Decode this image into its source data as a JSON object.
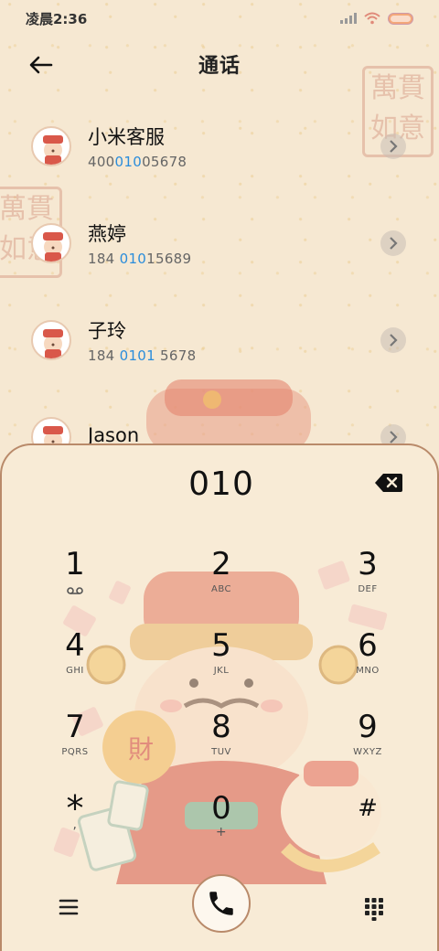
{
  "status_bar": {
    "time": "凌晨2:36"
  },
  "header": {
    "title": "通话"
  },
  "decor": {
    "seal_top_right": "萬貫\n如意",
    "seal_left": "萬貫\n如意"
  },
  "contacts": [
    {
      "name": "小米客服",
      "number_prefix": "400",
      "number_match": "010",
      "number_suffix": "05678"
    },
    {
      "name": "燕婷",
      "number_prefix": "184 ",
      "number_match": "010",
      "number_suffix": "15689"
    },
    {
      "name": "子玲",
      "number_prefix": "184 ",
      "number_match": "0101",
      "number_suffix": " 5678"
    },
    {
      "name": "Jason",
      "number_prefix": "",
      "number_match": "",
      "number_suffix": ""
    }
  ],
  "dialpad": {
    "input": "010",
    "keys": [
      {
        "digit": "1",
        "letters": ""
      },
      {
        "digit": "2",
        "letters": "ABC"
      },
      {
        "digit": "3",
        "letters": "DEF"
      },
      {
        "digit": "4",
        "letters": "GHI"
      },
      {
        "digit": "5",
        "letters": "JKL"
      },
      {
        "digit": "6",
        "letters": "MNO"
      },
      {
        "digit": "7",
        "letters": "PQRS"
      },
      {
        "digit": "8",
        "letters": "TUV"
      },
      {
        "digit": "9",
        "letters": "WXYZ"
      },
      {
        "digit": "*",
        "letters": ","
      },
      {
        "digit": "0",
        "letters": "+"
      },
      {
        "digit": "#",
        "letters": ""
      }
    ]
  },
  "colors": {
    "background": "#f6e8d2",
    "highlight": "#2b8ddb",
    "border": "#b98a6a"
  }
}
